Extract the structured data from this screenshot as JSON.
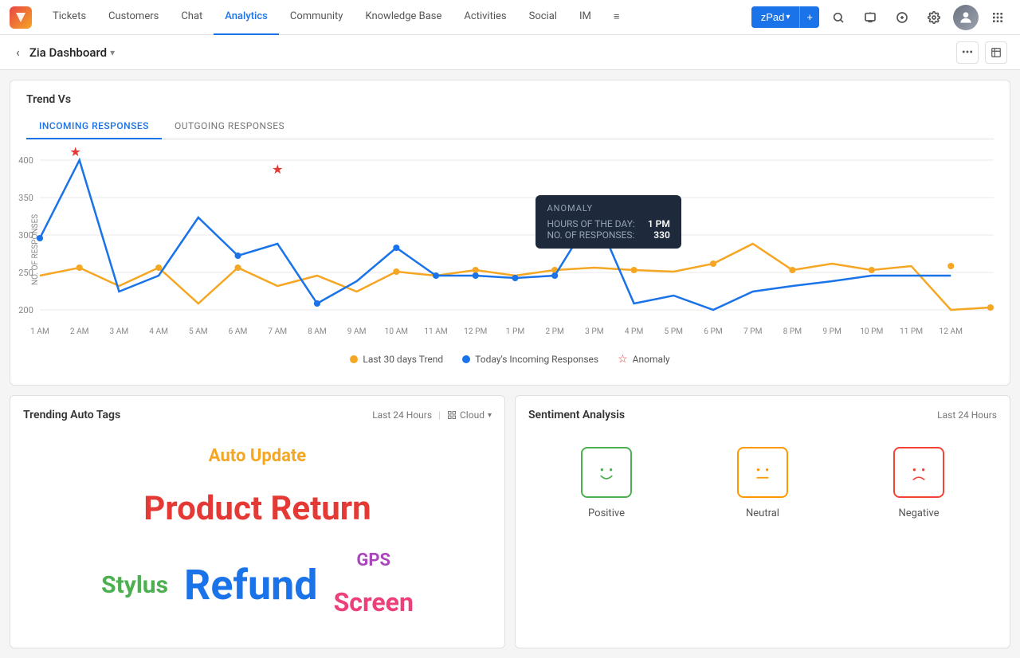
{
  "app": {
    "logo_text": "Z",
    "brand_color": "#e84545"
  },
  "topnav": {
    "items": [
      {
        "label": "Tickets",
        "active": false
      },
      {
        "label": "Customers",
        "active": false
      },
      {
        "label": "Chat",
        "active": false
      },
      {
        "label": "Analytics",
        "active": true
      },
      {
        "label": "Community",
        "active": false
      },
      {
        "label": "Knowledge Base",
        "active": false
      },
      {
        "label": "Activities",
        "active": false
      },
      {
        "label": "Social",
        "active": false
      },
      {
        "label": "IM",
        "active": false
      }
    ],
    "zpad_label": "zPad",
    "more_icon": "≡"
  },
  "subheader": {
    "back_icon": "‹",
    "title": "Zia Dashboard",
    "dropdown_icon": "▾",
    "more_icon": "•••",
    "expand_icon": "⛶"
  },
  "trend_card": {
    "title": "Trend Vs",
    "tabs": [
      {
        "label": "INCOMING RESPONSES",
        "active": true
      },
      {
        "label": "OUTGOING RESPONSES",
        "active": false
      }
    ],
    "y_axis_label": "NO. OF RESPONSES",
    "x_axis_labels": [
      "1 AM",
      "2 AM",
      "3 AM",
      "4 AM",
      "5 AM",
      "6 AM",
      "7 AM",
      "8 AM",
      "9 AM",
      "10 AM",
      "11 AM",
      "12 PM",
      "1 PM",
      "2 PM",
      "3 PM",
      "4 PM",
      "5 PM",
      "6 PM",
      "7 PM",
      "8 PM",
      "9 PM",
      "10 PM",
      "11 PM",
      "12 AM"
    ],
    "y_axis_values": [
      "400",
      "350",
      "300",
      "250",
      "200"
    ],
    "tooltip": {
      "title": "ANOMALY",
      "hours_label": "HOURS OF THE DAY:",
      "hours_value": "1 PM",
      "responses_label": "NO. OF RESPONSES:",
      "responses_value": "330"
    },
    "legend": [
      {
        "type": "dot",
        "color": "#f5a623",
        "label": "Last 30 days Trend"
      },
      {
        "type": "dot",
        "color": "#1a73e8",
        "label": "Today's Incoming Responses"
      },
      {
        "type": "star",
        "label": "Anomaly"
      }
    ]
  },
  "trending_tags": {
    "title": "Trending Auto Tags",
    "meta": "Last 24 Hours",
    "view_icon": "view",
    "cloud_label": "Cloud",
    "words": [
      {
        "text": "Auto Update",
        "color": "#f5a623",
        "size": 22
      },
      {
        "text": "Product Return",
        "color": "#e53935",
        "size": 42
      },
      {
        "text": "Stylus",
        "color": "#4caf50",
        "size": 30
      },
      {
        "text": "Refund",
        "color": "#1a73e8",
        "size": 52
      },
      {
        "text": "GPS",
        "color": "#ab47bc",
        "size": 22
      },
      {
        "text": "Screen",
        "color": "#ec407a",
        "size": 32
      }
    ]
  },
  "sentiment_analysis": {
    "title": "Sentiment Analysis",
    "meta": "Last 24 Hours",
    "items": [
      {
        "type": "positive",
        "label": "Positive",
        "icon": "☺",
        "border_color": "#4caf50"
      },
      {
        "type": "neutral",
        "label": "Neutral",
        "icon": "😐",
        "border_color": "#ff9800"
      },
      {
        "type": "negative",
        "label": "Negative",
        "icon": "☹",
        "border_color": "#f44336"
      }
    ]
  }
}
